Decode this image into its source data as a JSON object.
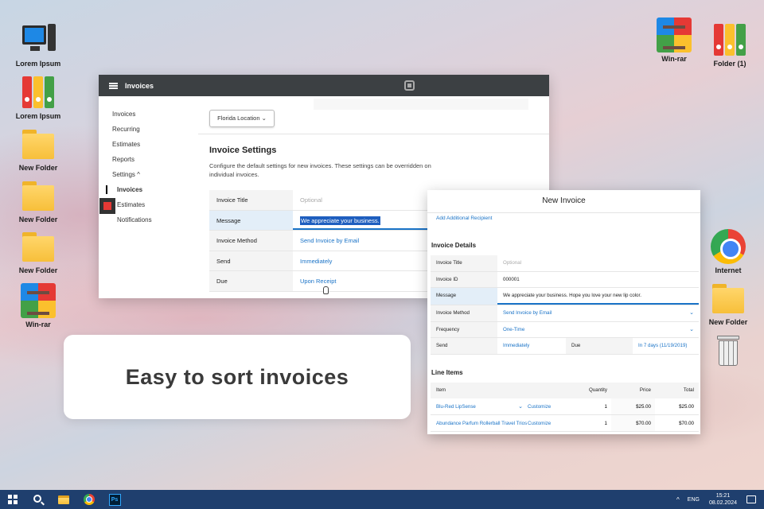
{
  "desktop": {
    "left_icons": [
      {
        "label": "Lorem Ipsum",
        "icon": "computer-icon"
      },
      {
        "label": "Lorem Ipsum",
        "icon": "binders-icon"
      },
      {
        "label": "New Folder",
        "icon": "folder-icon"
      },
      {
        "label": "New Folder",
        "icon": "folder-icon"
      },
      {
        "label": "New Folder",
        "icon": "folder-icon"
      },
      {
        "label": "Win-rar",
        "icon": "winrar-icon"
      }
    ],
    "right_icons": [
      {
        "label": "Win-rar",
        "icon": "winrar-icon"
      },
      {
        "label": "Folder (1)",
        "icon": "binders-icon"
      },
      {
        "label": "Internet",
        "icon": "chrome-icon"
      },
      {
        "label": "New Folder",
        "icon": "folder-icon"
      },
      {
        "label": "",
        "icon": "trash-icon"
      }
    ]
  },
  "invoices_window": {
    "title": "Invoices",
    "nav": [
      "Invoices",
      "Recurring",
      "Estimates",
      "Reports",
      "Settings ^",
      "Invoices",
      "Estimates",
      "Notifications"
    ],
    "location_button": "Florida Location ⌄",
    "section_title": "Invoice Settings",
    "section_desc": "Configure the default settings for new invoices. These settings can be overridden on individual invoices.",
    "rows": [
      {
        "label": "Invoice Title",
        "value": "Optional"
      },
      {
        "label": "Message",
        "value": "We appreciate your business."
      },
      {
        "label": "Invoice Method",
        "value": "Send Invoice by Email"
      },
      {
        "label": "Send",
        "value": "Immediately"
      },
      {
        "label": "Due",
        "value": "Upon Receipt"
      }
    ]
  },
  "new_invoice_window": {
    "title": "New Invoice",
    "add_recipient": "Add Additional Recipient",
    "details_title": "Invoice Details",
    "rows": [
      {
        "label": "Invoice Title",
        "value": "Optional"
      },
      {
        "label": "Invoice ID",
        "value": "000001"
      },
      {
        "label": "Message",
        "value": "We appreciate your business. Hope you love your new lip color."
      },
      {
        "label": "Invoice Method",
        "value": "Send Invoice by Email"
      },
      {
        "label": "Frequency",
        "value": "One-Time"
      }
    ],
    "send_label": "Send",
    "send_value": "Immediately",
    "due_label": "Due",
    "due_value": "In 7 days (11/19/2019)",
    "line_items_title": "Line Items",
    "line_headers": [
      "Item",
      "Quantity",
      "Price",
      "Total"
    ],
    "line_items": [
      {
        "item": "Blu-Red LipSense",
        "action": "Customize",
        "qty": "1",
        "price": "$25.00",
        "total": "$25.00"
      },
      {
        "item": "Abundance Parfum Rollerball Travel Trios",
        "action": "Customize",
        "qty": "1",
        "price": "$70.00",
        "total": "$70.00"
      }
    ]
  },
  "caption": "Easy to sort invoices",
  "taskbar": {
    "lang": "ENG",
    "time": "15:21",
    "date": "08.02.2024",
    "ps_label": "Ps"
  }
}
